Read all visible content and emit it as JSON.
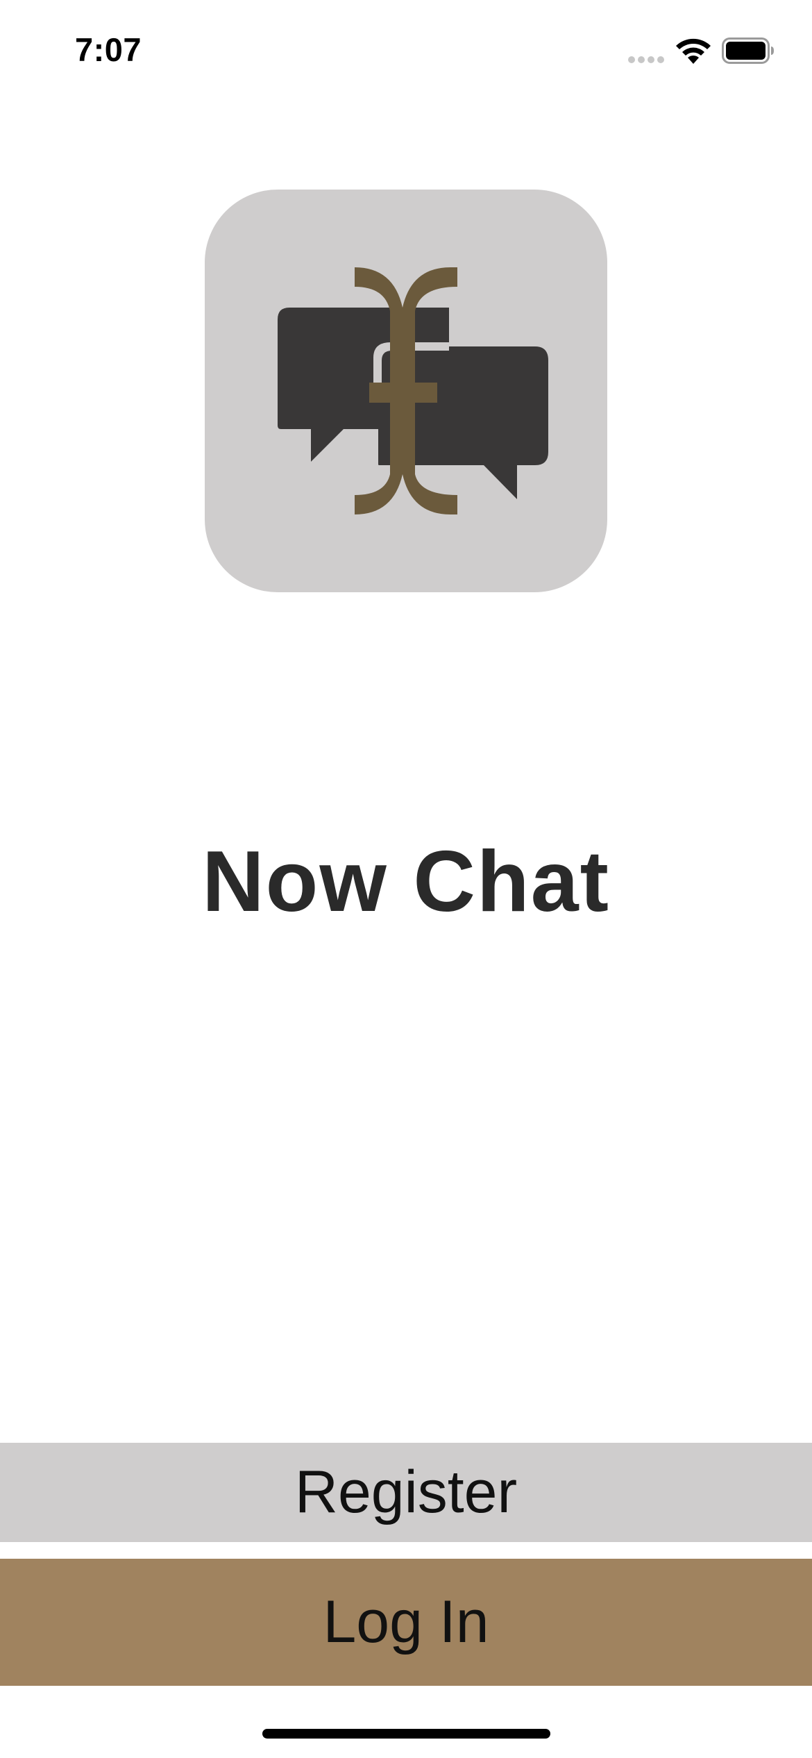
{
  "status_bar": {
    "time": "7:07",
    "icons": [
      "cellular-signal-icon",
      "wifi-icon",
      "battery-icon"
    ]
  },
  "app": {
    "icon": "now-chat-logo-icon",
    "title": "Now Chat"
  },
  "actions": {
    "register_label": "Register",
    "login_label": "Log In"
  },
  "colors": {
    "icon_background": "#cfcdcd",
    "bubble": "#393737",
    "brand_bronze": "#6b5a3c",
    "register_button": "#cfcdcd",
    "login_button": "#a0835f",
    "title_text": "#2a2a2a"
  }
}
